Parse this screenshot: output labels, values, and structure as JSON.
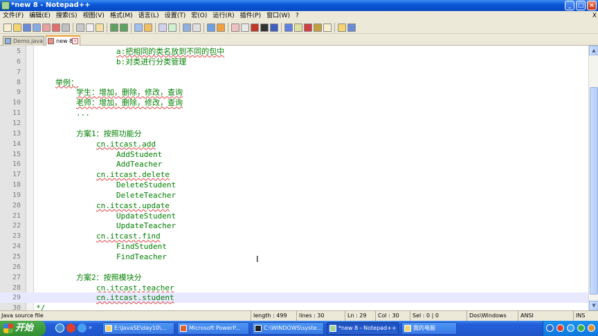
{
  "window": {
    "title": "*new  8 - Notepad++",
    "controls": {
      "minimize": "_",
      "maximize": "□",
      "close": "×"
    }
  },
  "menu": {
    "items": [
      "文件(F)",
      "编辑(E)",
      "搜索(S)",
      "视图(V)",
      "格式(M)",
      "语言(L)",
      "设置(T)",
      "宏(O)",
      "运行(R)",
      "插件(P)",
      "窗口(W)",
      "?"
    ],
    "close_doc": "X"
  },
  "toolbar": {
    "buttons": [
      "new-file-icon",
      "open-file-icon",
      "save-icon",
      "save-all-icon",
      "close-icon",
      "close-all-icon",
      "print-icon",
      "sep",
      "cut-icon",
      "copy-icon",
      "paste-icon",
      "sep",
      "undo-icon",
      "redo-icon",
      "sep",
      "find-icon",
      "replace-icon",
      "sep",
      "zoom-in-icon",
      "zoom-out-icon",
      "sep",
      "sync-v-icon",
      "sync-h-icon",
      "sep",
      "wrap-icon",
      "all-chars-icon",
      "sep",
      "indent-guide-icon",
      "lang-icon",
      "doc-map-icon",
      "func-list-icon",
      "folder-icon",
      "sep",
      "record-icon",
      "stop-icon",
      "play-icon",
      "play-multi-icon",
      "save-macro-icon",
      "sep",
      "spellcheck-icon",
      "spellcheck-settings-icon"
    ]
  },
  "tabs": [
    {
      "label": "Demo.java",
      "active": false
    },
    {
      "label": "new  8",
      "active": true
    }
  ],
  "editor": {
    "current_line": 29,
    "lines": [
      {
        "n": "5",
        "text": "a:把相同的类名放到不同的包中",
        "indent": 4,
        "underline": true
      },
      {
        "n": "6",
        "text": "b:对类进行分类管理",
        "indent": 4,
        "underline": false
      },
      {
        "n": "7",
        "text": "",
        "indent": 0,
        "underline": false
      },
      {
        "n": "8",
        "text": "举例：",
        "indent": 1,
        "underline": true
      },
      {
        "n": "9",
        "text": "学生：增加，删除，修改，查询",
        "indent": 2,
        "underline": true
      },
      {
        "n": "10",
        "text": "老师：增加，删除，修改，查询",
        "indent": 2,
        "underline": true
      },
      {
        "n": "11",
        "text": "...",
        "indent": 2,
        "underline": false
      },
      {
        "n": "12",
        "text": "",
        "indent": 0,
        "underline": false
      },
      {
        "n": "13",
        "text": "方案1：按照功能分",
        "indent": 2,
        "underline": false
      },
      {
        "n": "14",
        "text": "cn.itcast.add",
        "indent": 3,
        "underline": true
      },
      {
        "n": "15",
        "text": "AddStudent",
        "indent": 4,
        "underline": false
      },
      {
        "n": "16",
        "text": "AddTeacher",
        "indent": 4,
        "underline": false
      },
      {
        "n": "17",
        "text": "cn.itcast.delete",
        "indent": 3,
        "underline": true
      },
      {
        "n": "18",
        "text": "DeleteStudent",
        "indent": 4,
        "underline": false
      },
      {
        "n": "19",
        "text": "DeleteTeacher",
        "indent": 4,
        "underline": false
      },
      {
        "n": "20",
        "text": "cn.itcast.update",
        "indent": 3,
        "underline": true
      },
      {
        "n": "21",
        "text": "UpdateStudent",
        "indent": 4,
        "underline": false
      },
      {
        "n": "22",
        "text": "UpdateTeacher",
        "indent": 4,
        "underline": false
      },
      {
        "n": "23",
        "text": "cn.itcast.find",
        "indent": 3,
        "underline": true
      },
      {
        "n": "24",
        "text": "FindStudent",
        "indent": 4,
        "underline": false
      },
      {
        "n": "25",
        "text": "FindTeacher",
        "indent": 4,
        "underline": false
      },
      {
        "n": "26",
        "text": "",
        "indent": 0,
        "underline": false
      },
      {
        "n": "27",
        "text": "方案2：按照模块分",
        "indent": 2,
        "underline": false
      },
      {
        "n": "28",
        "text": "cn.itcast.teacher",
        "indent": 3,
        "underline": true
      },
      {
        "n": "29",
        "text": "cn.itcast.student",
        "indent": 3,
        "underline": true
      },
      {
        "n": "30",
        "text": "*/",
        "indent": 0,
        "underline": false
      }
    ]
  },
  "statusbar": {
    "filetype": "Java source file",
    "length": "length : 499",
    "lines": "lines : 30",
    "ln": "Ln : 29",
    "col": "Col : 30",
    "sel": "Sel : 0 | 0",
    "eol": "Dos\\Windows",
    "encoding": "ANSI",
    "mode": "INS"
  },
  "taskbar": {
    "start_label": "开始",
    "tasks": [
      {
        "label": "E:\\JavaSE\\day10\\...",
        "active": false
      },
      {
        "label": "Microsoft PowerP...",
        "active": false
      },
      {
        "label": "C:\\WINDOWS\\syste...",
        "active": false
      },
      {
        "label": "*new  8 - Notepad++",
        "active": true
      },
      {
        "label": "我的电脑",
        "active": false
      }
    ]
  },
  "colors": {
    "code_text": "#008000",
    "line_numbers": "#808080",
    "current_line": "#e8e8ff",
    "spell_underline": "#e04040"
  }
}
